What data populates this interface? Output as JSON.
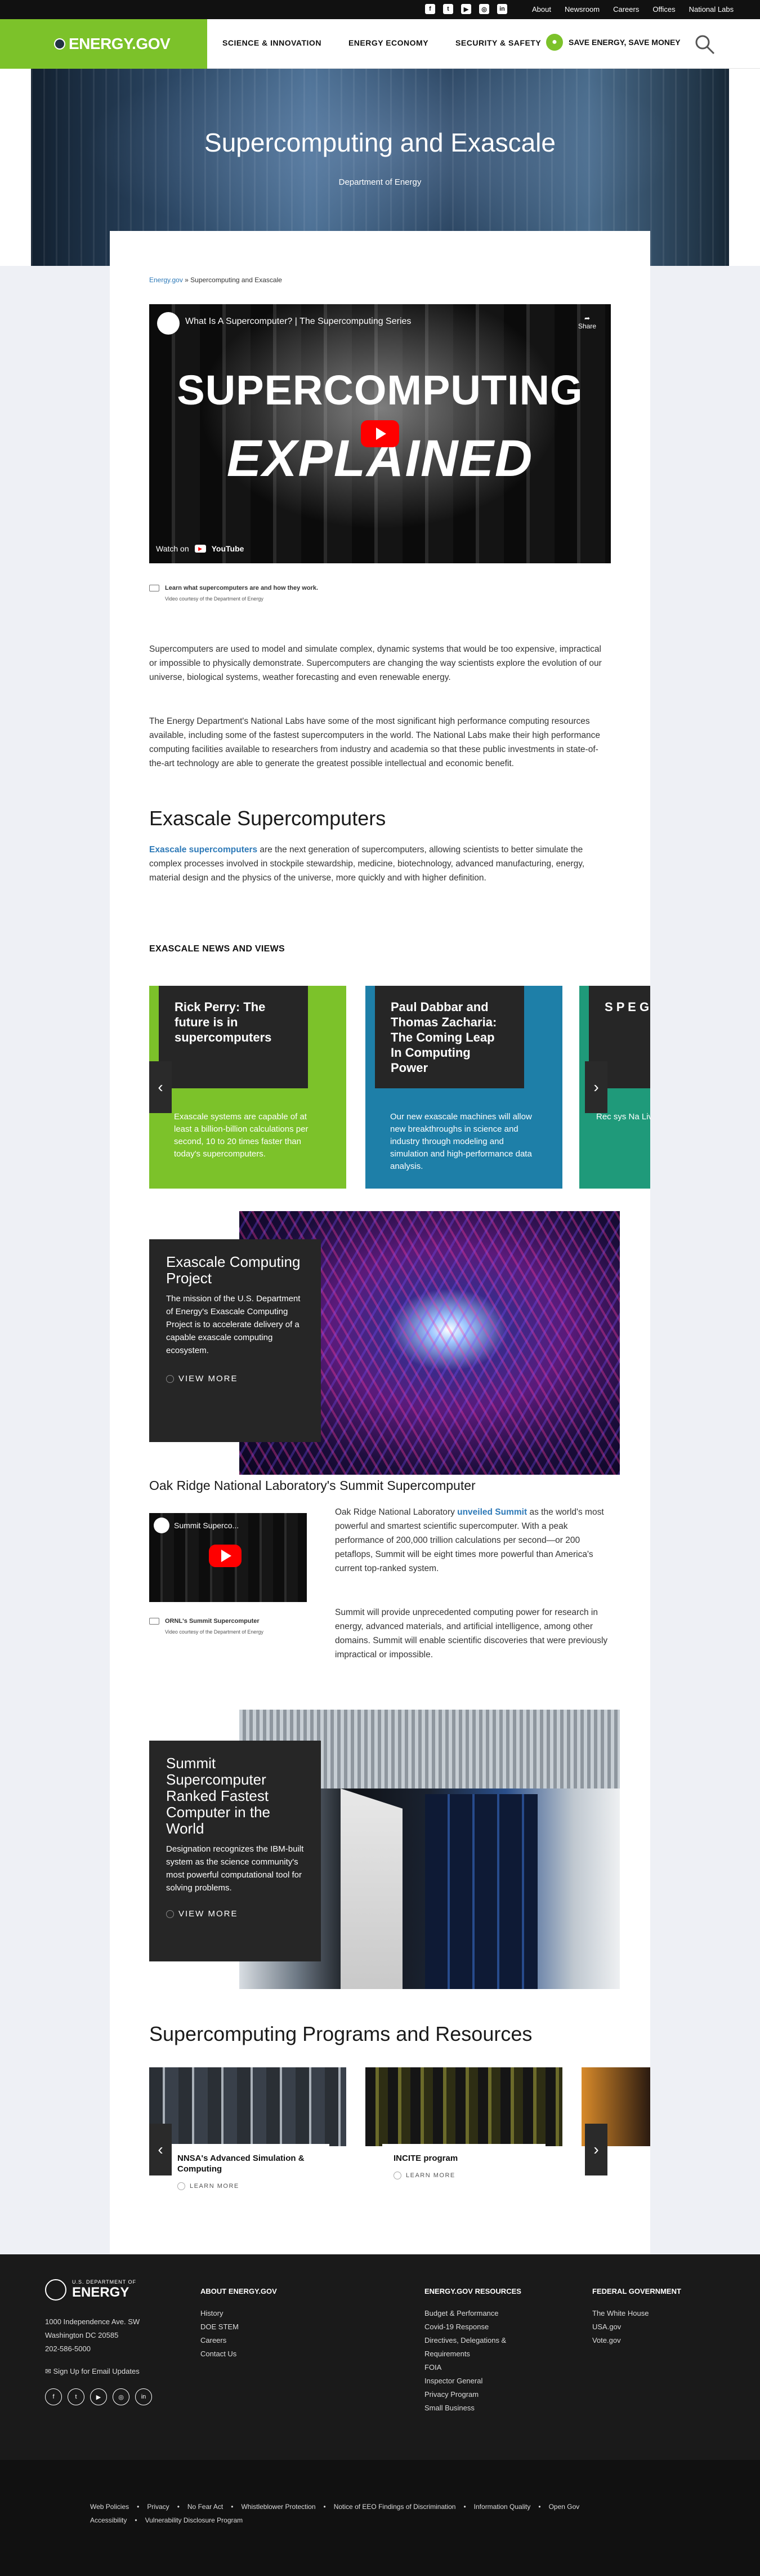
{
  "topbar": {
    "social": [
      "f",
      "t",
      "▶",
      "◎",
      "in"
    ],
    "links": [
      "About",
      "Newsroom",
      "Careers",
      "Offices",
      "National Labs"
    ]
  },
  "header": {
    "logo": "ENERGY.GOV",
    "nav": [
      "SCIENCE & INNOVATION",
      "ENERGY ECONOMY",
      "SECURITY & SAFETY"
    ],
    "save": "SAVE ENERGY, SAVE MONEY"
  },
  "hero": {
    "title": "Supercomputing and Exascale",
    "subtitle": "Department of Energy"
  },
  "breadcrumb": {
    "home": "Energy.gov",
    "sep": " » ",
    "current": "Supercomputing and Exascale"
  },
  "video1": {
    "title": "What Is A Supercomputer? | The Supercomputing Series",
    "share": "Share",
    "line1": "SUPERCOMPUTING",
    "line2": "EXPLAINED",
    "watch": "Watch on",
    "yt": "YouTube",
    "caption": "Learn what supercomputers are and how they work.",
    "credit": "Video courtesy of the Department of Energy"
  },
  "intro": {
    "p1": "Supercomputers are used to model and simulate complex, dynamic systems that would be too expensive, impractical or impossible to physically demonstrate. Supercomputers are changing the way scientists explore the evolution of our universe, biological systems, weather forecasting and even renewable energy.",
    "p2": "The Energy Department's National Labs have some of the most significant high performance computing resources available, including some of the fastest supercomputers in the world. The National Labs make their high performance computing facilities available to researchers from industry and academia so that these public investments in state-of-the-art technology are able to generate the greatest possible intellectual and economic benefit."
  },
  "exascale": {
    "heading": "Exascale Supercomputers",
    "link": "Exascale supercomputers",
    "text": " are the next generation of supercomputers, allowing scientists to better simulate the complex processes involved in stockpile stewardship, medicine, biotechnology, advanced manufacturing, energy, material design and the physics of the universe, more quickly and with higher definition."
  },
  "news": {
    "heading": "EXASCALE NEWS AND VIEWS",
    "cards": [
      {
        "title": "Rick Perry: The future is in supercomputers",
        "body": "Exascale systems are capable of at least a billion-billion calculations per second, 10 to 20 times faster than today's supercomputers.",
        "color": "#7cc22a"
      },
      {
        "title": "Paul Dabbar and Thomas Zacharia: The Coming Leap In Computing Power",
        "body": "Our new exascale machines will allow new breakthroughs in science and industry through modeling and simulation and high-performance data analysis.",
        "color": "#1e7fa8"
      },
      {
        "title": "S P E G",
        "body": "Rec sys Na Liv",
        "color": "#1f9a7a"
      }
    ]
  },
  "feature1": {
    "title": "Exascale Computing Project",
    "desc": "The mission of the U.S. Department of Energy's Exascale Computing Project is to accelerate delivery of a capable exascale computing ecosystem.",
    "more": "VIEW MORE"
  },
  "summit": {
    "heading": "Oak Ridge National Laboratory's Summit Supercomputer",
    "video_title": "Summit Superco...",
    "video_caption": "ORNL's Summit Supercomputer",
    "video_credit": "Video courtesy of the Department of Energy",
    "p1a": "Oak Ridge National Laboratory ",
    "p1link": "unveiled Summit",
    "p1b": " as the world's most powerful and smartest scientific supercomputer. With a peak performance of 200,000 trillion calculations per second—or 200 petaflops, Summit will be eight times more powerful than America's current top-ranked system.",
    "p2": "Summit will provide unprecedented computing power for research in energy, advanced materials, and artificial intelligence, among other domains. Summit will enable scientific discoveries that were previously impractical or impossible."
  },
  "feature2": {
    "title": "Summit Supercomputer Ranked Fastest Computer in the World",
    "desc": "Designation recognizes the IBM-built system as the science community's most powerful computational tool for solving problems.",
    "more": "VIEW MORE"
  },
  "resources": {
    "heading": "Supercomputing Programs and Resources",
    "cards": [
      {
        "title": "NNSA's Advanced Simulation & Computing",
        "more": "LEARN MORE"
      },
      {
        "title": "INCITE program",
        "more": "LEARN MORE"
      }
    ]
  },
  "footer": {
    "dept_small": "U.S. DEPARTMENT OF",
    "dept_big": "ENERGY",
    "address": [
      "1000 Independence Ave. SW",
      "Washington DC 20585",
      "202-586-5000"
    ],
    "signup": "Sign Up for Email Updates",
    "social": [
      "f",
      "t",
      "▶",
      "◎",
      "in"
    ],
    "about_h": "ABOUT ENERGY.GOV",
    "about": [
      "History",
      "DOE STEM",
      "Careers",
      "Contact Us"
    ],
    "res_h": "ENERGY.GOV RESOURCES",
    "res": [
      "Budget & Performance",
      "Covid-19 Response",
      "Directives, Delegations & Requirements",
      "FOIA",
      "Inspector General",
      "Privacy Program",
      "Small Business"
    ],
    "fed_h": "FEDERAL GOVERNMENT",
    "fed": [
      "The White House",
      "USA.gov",
      "Vote.gov"
    ],
    "bottom1": [
      "Web Policies",
      "Privacy",
      "No Fear Act",
      "Whistleblower Protection",
      "Notice of EEO Findings of Discrimination",
      "Information Quality",
      "Open Gov"
    ],
    "bottom2": [
      "Accessibility",
      "Vulnerability Disclosure Program"
    ]
  }
}
